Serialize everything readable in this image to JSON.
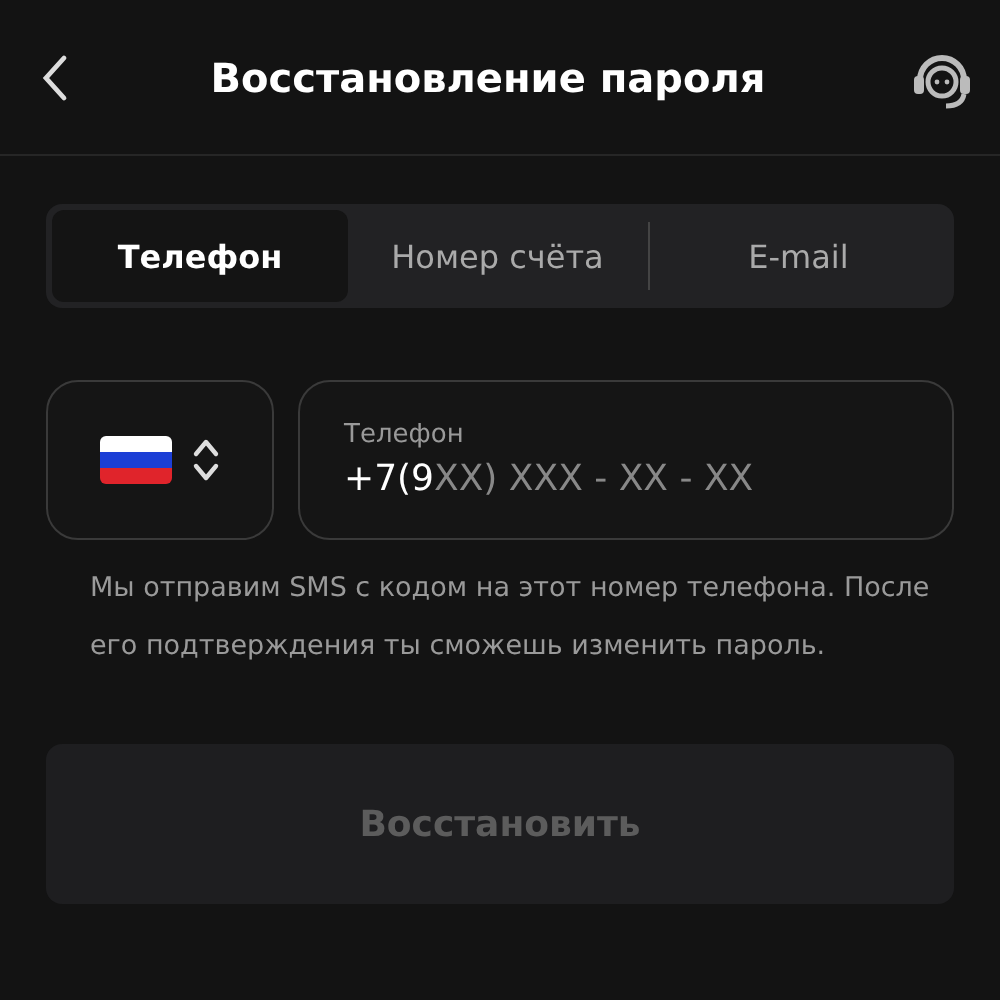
{
  "header": {
    "title": "Восстановление пароля"
  },
  "tabs": [
    {
      "label": "Телефон",
      "selected": true
    },
    {
      "label": "Номер счёта",
      "selected": false
    },
    {
      "label": "E-mail",
      "selected": false
    }
  ],
  "phone_field": {
    "label": "Телефон",
    "value": "+7(9",
    "mask": "XX) XXX - XX - XX"
  },
  "hint": "Мы отправим SMS с кодом на этот номер телефона. После его подтверждения ты сможешь изменить пароль.",
  "submit": {
    "label": "Восстановить",
    "disabled": true
  }
}
